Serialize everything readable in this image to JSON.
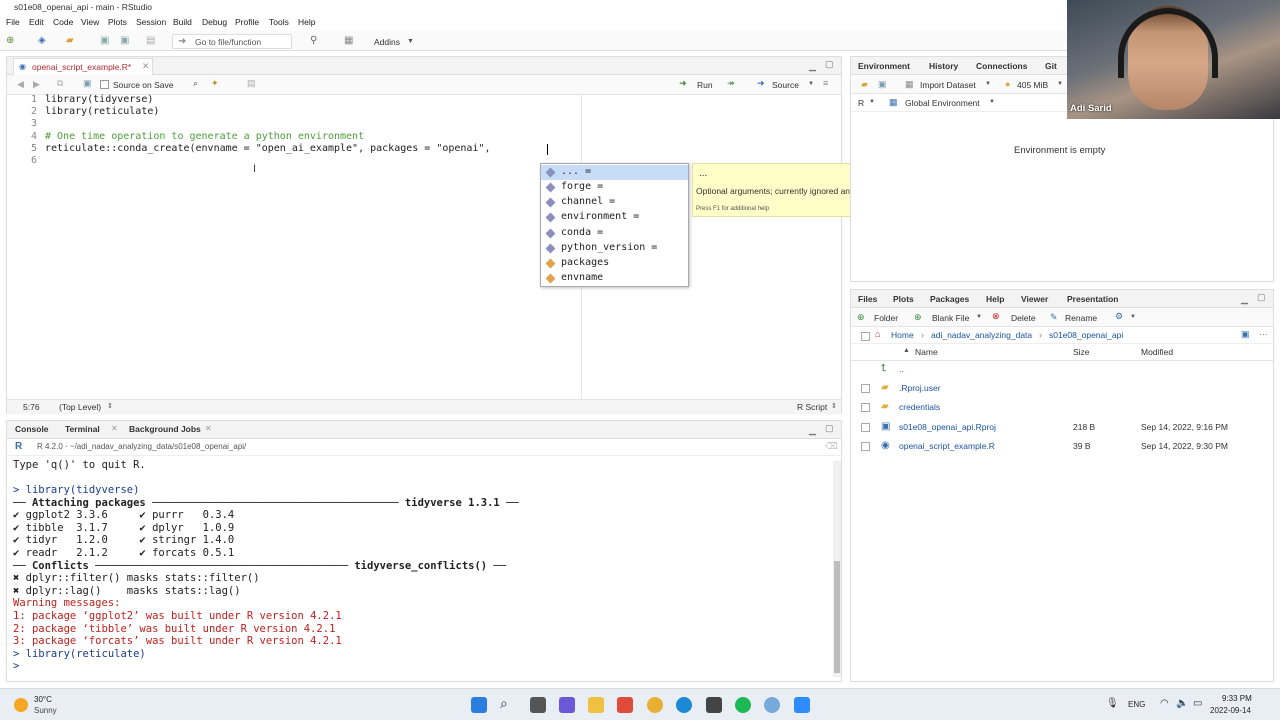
{
  "window": {
    "title": "s01e08_openai_api - main - RStudio"
  },
  "menu": [
    "File",
    "Edit",
    "Code",
    "View",
    "Plots",
    "Session",
    "Build",
    "Debug",
    "Profile",
    "Tools",
    "Help"
  ],
  "toolbar": {
    "goto_placeholder": "Go to file/function",
    "addins": "Addins"
  },
  "editor": {
    "tab_label": "openai_script_example.R*",
    "source_on_save": "Source on Save",
    "run": "Run",
    "source": "Source",
    "lines": [
      {
        "n": "1",
        "code": "library(tidyverse)"
      },
      {
        "n": "2",
        "code": "library(reticulate)"
      },
      {
        "n": "3",
        "code": ""
      },
      {
        "n": "4",
        "code": "# One time operation to generate a python environment"
      },
      {
        "n": "5",
        "code": "reticulate::conda_create(envname = \"open_ai_example\", packages = \"openai\", "
      },
      {
        "n": "6",
        "code": ""
      }
    ],
    "status_pos": "5:76",
    "status_scope": "(Top Level)",
    "status_type": "R Script"
  },
  "autocomplete": {
    "items": [
      "... =",
      "forge =",
      "channel =",
      "environment =",
      "conda =",
      "python_version =",
      "packages",
      "envname"
    ],
    "tip_title": "...",
    "tip_text": "Optional arguments; currently ignored and reserved for future expansion.",
    "tip_help": "Press F1 for additional help"
  },
  "console": {
    "tabs": [
      "Console",
      "Terminal",
      "Background Jobs"
    ],
    "header": "R 4.2.0 · ~/adi_nadav_analyzing_data/s01e08_openai_api/",
    "lines": [
      {
        "t": "Type 'q()' to quit R.",
        "c": ""
      },
      {
        "t": "",
        "c": ""
      },
      {
        "t": "> library(tidyverse)",
        "c": "blue"
      },
      {
        "t": "── Attaching packages ─────────────────────────────────────── tidyverse 1.3.1 ──",
        "c": ""
      },
      {
        "t": "✔ ggplot2 3.3.6     ✔ purrr   0.3.4",
        "c": ""
      },
      {
        "t": "✔ tibble  3.1.7     ✔ dplyr   1.0.9",
        "c": ""
      },
      {
        "t": "✔ tidyr   1.2.0     ✔ stringr 1.4.0",
        "c": ""
      },
      {
        "t": "✔ readr   2.1.2     ✔ forcats 0.5.1",
        "c": ""
      },
      {
        "t": "── Conflicts ──────────────────────────────────────── tidyverse_conflicts() ──",
        "c": ""
      },
      {
        "t": "✖ dplyr::filter() masks stats::filter()",
        "c": ""
      },
      {
        "t": "✖ dplyr::lag()    masks stats::lag()",
        "c": ""
      },
      {
        "t": "Warning messages:",
        "c": "red"
      },
      {
        "t": "1: package ‘ggplot2’ was built under R version 4.2.1",
        "c": "red"
      },
      {
        "t": "2: package ‘tibble’ was built under R version 4.2.1",
        "c": "red"
      },
      {
        "t": "3: package ‘forcats’ was built under R version 4.2.1",
        "c": "red"
      },
      {
        "t": "> library(reticulate)",
        "c": "blue"
      },
      {
        "t": "> ",
        "c": "blue"
      }
    ]
  },
  "env": {
    "tabs": [
      "Environment",
      "History",
      "Connections",
      "Git"
    ],
    "import": "Import Dataset",
    "memory": "405 MiB",
    "lang": "R",
    "scope": "Global Environment",
    "empty": "Environment is empty"
  },
  "files": {
    "tabs": [
      "Files",
      "Plots",
      "Packages",
      "Help",
      "Viewer",
      "Presentation"
    ],
    "new_folder": "Folder",
    "blank_file": "Blank File",
    "delete": "Delete",
    "rename": "Rename",
    "crumbs": [
      "Home",
      "adi_nadav_analyzing_data",
      "s01e08_openai_api"
    ],
    "columns": {
      "name": "Name",
      "size": "Size",
      "modified": "Modified"
    },
    "rows": [
      {
        "name": "..",
        "size": "",
        "modified": ""
      },
      {
        "name": ".Rproj.user",
        "size": "",
        "modified": ""
      },
      {
        "name": "credentials",
        "size": "",
        "modified": ""
      },
      {
        "name": "s01e08_openai_api.Rproj",
        "size": "218 B",
        "modified": "Sep 14, 2022, 9:16 PM"
      },
      {
        "name": "openai_script_example.R",
        "size": "39 B",
        "modified": "Sep 14, 2022, 9:30 PM"
      }
    ]
  },
  "video": {
    "name": "Adi Sarid"
  },
  "taskbar": {
    "temp": "30°C",
    "weather": "Sunny",
    "lang": "ENG",
    "time": "9:33 PM",
    "date": "2022-09-14"
  }
}
